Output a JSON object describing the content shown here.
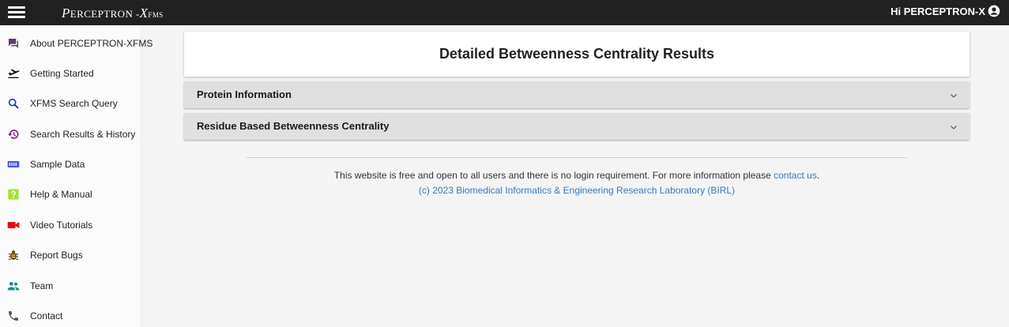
{
  "header": {
    "logo_prefix": "P",
    "logo_main": "ERCEPTRON -",
    "logo_x": "X",
    "logo_suffix": "FMS",
    "greeting": "Hi PERCEPTRON-X"
  },
  "sidebar": {
    "items": [
      {
        "label": "About PERCEPTRON-XFMS",
        "icon": "chat-icon",
        "color": "#5e3a6e"
      },
      {
        "label": "Getting Started",
        "icon": "airplane-takeoff-icon",
        "color": "#111111"
      },
      {
        "label": "XFMS Search Query",
        "icon": "search-icon",
        "color": "#1a3fa8"
      },
      {
        "label": "Search Results & History",
        "icon": "history-icon",
        "color": "#7a1f7a"
      },
      {
        "label": "Sample Data",
        "icon": "storage-icon",
        "color": "#4a55d8"
      },
      {
        "label": "Help & Manual",
        "icon": "help-icon",
        "color": "#a6e23a"
      },
      {
        "label": "Video Tutorials",
        "icon": "video-camera-icon",
        "color": "#e01010"
      },
      {
        "label": "Report Bugs",
        "icon": "bug-icon",
        "color": "#7a4a12"
      },
      {
        "label": "Team",
        "icon": "team-icon",
        "color": "#128a84"
      },
      {
        "label": "Contact",
        "icon": "phone-icon",
        "color": "#555555"
      }
    ]
  },
  "main": {
    "title": "Detailed Betweenness Centrality Results",
    "panels": [
      {
        "label": "Protein Information"
      },
      {
        "label": "Residue Based Betweenness Centrality"
      }
    ]
  },
  "footer": {
    "text": "This website is free and open to all users and there is no login requirement. For more information please ",
    "link": "contact us",
    "period": ".",
    "copyright": "(c) 2023 Biomedical Informatics & Engineering Research Laboratory (BIRL)"
  },
  "colors": {
    "topbar": "#212121",
    "link": "#3c78b4",
    "panel": "#e0e0e0"
  }
}
